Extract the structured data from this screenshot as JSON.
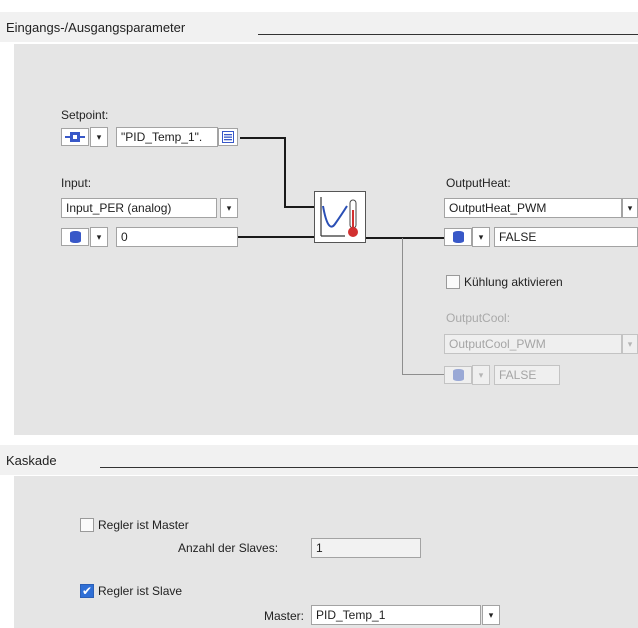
{
  "io_section": {
    "title": "Eingangs-/Ausgangsparameter",
    "setpoint": {
      "label": "Setpoint:",
      "value": "\"PID_Temp_1\"."
    },
    "input": {
      "label": "Input:",
      "selected": "Input_PER (analog)",
      "value": "0"
    },
    "output_heat": {
      "label": "OutputHeat:",
      "selected": "OutputHeat_PWM",
      "value": "FALSE"
    },
    "cooling_checkbox": {
      "label": "Kühlung aktivieren",
      "checked": false
    },
    "output_cool": {
      "label": "OutputCool:",
      "selected": "OutputCool_PWM",
      "value": "FALSE"
    }
  },
  "cascade_section": {
    "title": "Kaskade",
    "master_checkbox": {
      "label": "Regler ist Master",
      "checked": false
    },
    "slaves_count": {
      "label": "Anzahl der Slaves:",
      "value": "1"
    },
    "slave_checkbox": {
      "label": "Regler ist Slave",
      "checked": true
    },
    "master_select": {
      "label": "Master:",
      "selected": "PID_Temp_1"
    }
  },
  "icons": {
    "dropdown_arrow": "▾",
    "check_mark": "✔",
    "memory_cylinder": "memory-cylinder-icon",
    "connector": "connector-icon",
    "browse": "browse-icon",
    "pid_controller": "pid-controller-icon"
  },
  "colors": {
    "accent_blue": "#3858c8",
    "check_blue": "#2f6fd6",
    "panel": "#e5e5e5",
    "header": "#f1f1f1",
    "thermometer": "#d23030"
  }
}
